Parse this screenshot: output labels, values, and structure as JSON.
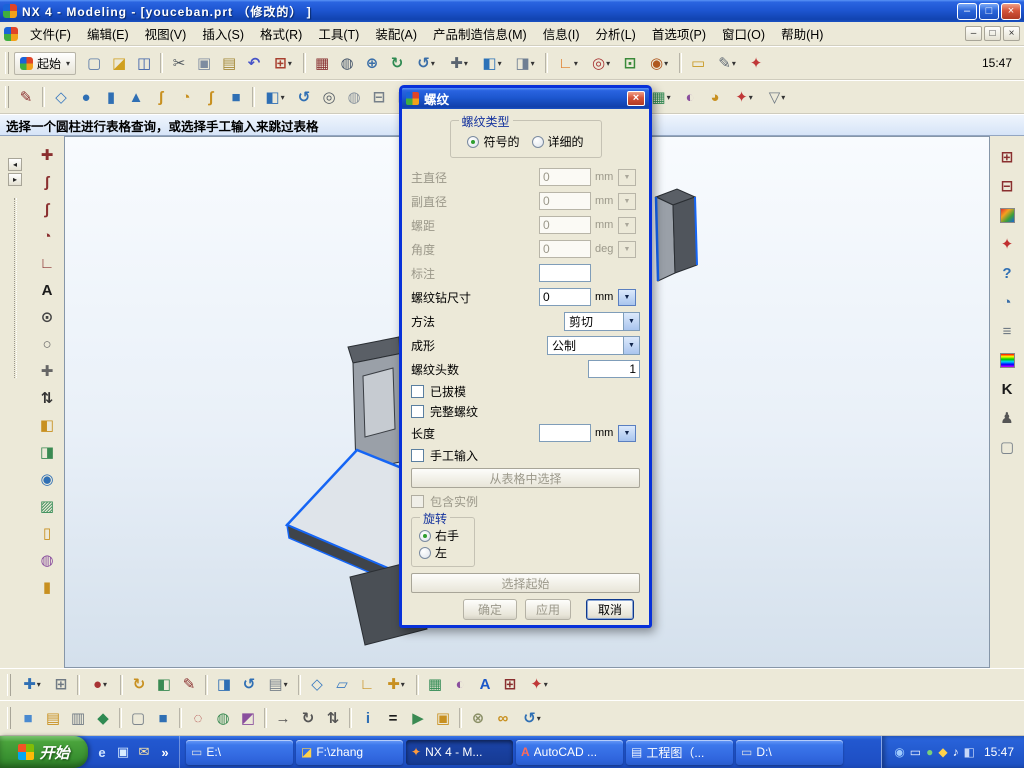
{
  "window": {
    "title": "NX 4 - Modeling - [youceban.prt （修改的） ]",
    "controls": {
      "minimize": "–",
      "maximize": "□",
      "close": "×"
    }
  },
  "menubar": {
    "items": [
      {
        "name": "file",
        "label": "文件(F)"
      },
      {
        "name": "edit",
        "label": "编辑(E)"
      },
      {
        "name": "view",
        "label": "视图(V)"
      },
      {
        "name": "insert",
        "label": "插入(S)"
      },
      {
        "name": "format",
        "label": "格式(R)"
      },
      {
        "name": "tools",
        "label": "工具(T)"
      },
      {
        "name": "assemblies",
        "label": "装配(A)"
      },
      {
        "name": "pmi",
        "label": "产品制造信息(M)"
      },
      {
        "name": "information",
        "label": "信息(I)"
      },
      {
        "name": "analysis",
        "label": "分析(L)"
      },
      {
        "name": "preferences",
        "label": "首选项(P)"
      },
      {
        "name": "window",
        "label": "窗口(O)"
      },
      {
        "name": "help",
        "label": "帮助(H)"
      }
    ],
    "mdi_controls": {
      "minimize": "–",
      "restore": "□",
      "close": "×"
    }
  },
  "toolbars": {
    "start_button": {
      "label": "起始"
    },
    "clock": "15:47",
    "row1": [
      {
        "name": "new-part",
        "glyph": "▢",
        "color": "#5a7aa8"
      },
      {
        "name": "open-part",
        "glyph": "◪",
        "color": "#d0a020"
      },
      {
        "name": "save-part",
        "glyph": "◫",
        "color": "#3a5fa8"
      },
      {
        "sep": true
      },
      {
        "name": "cut",
        "glyph": "✂",
        "color": "#50585f"
      },
      {
        "name": "copy",
        "glyph": "▣",
        "color": "#7e8ca0"
      },
      {
        "name": "paste",
        "glyph": "▤",
        "color": "#a58a3a"
      },
      {
        "name": "undo",
        "glyph": "↶",
        "color": "#4653c8"
      },
      {
        "name": "pick-filter",
        "glyph": "⊞",
        "color": "#a84030",
        "dropdown": true
      },
      {
        "sep": true
      },
      {
        "name": "fit-view",
        "glyph": "▦",
        "color": "#8a3434"
      },
      {
        "name": "zoom-window",
        "glyph": "◍",
        "color": "#48586c"
      },
      {
        "name": "zoom-in-out",
        "glyph": "⊕",
        "color": "#3a6ea8"
      },
      {
        "name": "refresh-view",
        "glyph": "↻",
        "color": "#2f8a52"
      },
      {
        "name": "rotate-view",
        "glyph": "↺",
        "color": "#3a6ea8",
        "dropdown": true
      },
      {
        "name": "pan-view",
        "glyph": "✚",
        "color": "#5a6470",
        "dropdown": true
      },
      {
        "name": "shaded-display",
        "glyph": "◧",
        "color": "#2c72b8",
        "dropdown": true
      },
      {
        "name": "wireframe-display",
        "glyph": "◨",
        "color": "#6f7f93",
        "dropdown": true
      },
      {
        "sep": true
      },
      {
        "name": "orient-csys",
        "glyph": "∟",
        "color": "#e07820",
        "dropdown": true
      },
      {
        "name": "snap-options",
        "glyph": "◎",
        "color": "#a83434",
        "dropdown": true
      },
      {
        "name": "layer-settings",
        "glyph": "⊡",
        "color": "#3a8a3a"
      },
      {
        "name": "selection-ball",
        "glyph": "◉",
        "color": "#b05820",
        "dropdown": true
      },
      {
        "sep": true
      },
      {
        "name": "measure-distance",
        "glyph": "▭",
        "color": "#c89820"
      },
      {
        "name": "annotation-pencil",
        "glyph": "✎",
        "color": "#606a75",
        "dropdown": true
      },
      {
        "name": "customize-wheel",
        "glyph": "✦",
        "color": "#c03838"
      }
    ],
    "row2": [
      {
        "name": "sketch",
        "glyph": "✎",
        "color": "#8a2f2f"
      },
      {
        "sep": true
      },
      {
        "name": "datum-plane",
        "glyph": "◇",
        "color": "#3a7ac0"
      },
      {
        "name": "sphere",
        "glyph": "●",
        "color": "#2f6fb4"
      },
      {
        "name": "cylinder",
        "glyph": "▮",
        "color": "#2f6fb4"
      },
      {
        "name": "cone",
        "glyph": "▲",
        "color": "#2f6fb4"
      },
      {
        "name": "studio-spline",
        "glyph": "ʃ",
        "color": "#c89020"
      },
      {
        "name": "arc-curve",
        "glyph": "◔",
        "color": "#c89020"
      },
      {
        "name": "helix",
        "glyph": "∫",
        "color": "#c89020"
      },
      {
        "name": "block",
        "glyph": "■",
        "color": "#2f6fb4"
      },
      {
        "sep": true
      },
      {
        "name": "extrude",
        "glyph": "◧",
        "color": "#2f6fb4",
        "dropdown": true
      },
      {
        "name": "revolve",
        "glyph": "↺",
        "color": "#2f6fb4"
      },
      {
        "name": "hole",
        "glyph": "◎",
        "color": "#565e66"
      },
      {
        "name": "boss",
        "glyph": "◍",
        "color": "#8a949e"
      },
      {
        "name": "pocket",
        "glyph": "⊟",
        "color": "#76808a"
      },
      {
        "name": "pad",
        "glyph": "⊞",
        "color": "#76808a"
      },
      {
        "name": "thread-feature",
        "glyph": "ξ",
        "color": "#b07c20"
      },
      {
        "sep": true
      },
      {
        "name": "unite",
        "glyph": "⊕",
        "color": "#2f6fb4"
      },
      {
        "name": "subtract",
        "glyph": "⊖",
        "color": "#2f6fb4"
      },
      {
        "name": "intersect",
        "glyph": "⊗",
        "color": "#2f6fb4"
      },
      {
        "name": "edge-blend",
        "glyph": "◈",
        "color": "#3a7ac0",
        "dropdown": true
      },
      {
        "name": "chamfer",
        "glyph": "◣",
        "color": "#3a7ac0"
      },
      {
        "name": "shell",
        "glyph": "▢",
        "color": "#3a7ac0"
      },
      {
        "name": "trim-body",
        "glyph": "✂",
        "color": "#707a84"
      },
      {
        "sep": true
      },
      {
        "name": "instance-array",
        "glyph": "▦",
        "color": "#2f8a52",
        "dropdown": true
      },
      {
        "name": "mirror-body",
        "glyph": "◐",
        "color": "#8a4f9e"
      },
      {
        "name": "free-form",
        "glyph": "◕",
        "color": "#c89020"
      },
      {
        "name": "gear-tools",
        "glyph": "✦",
        "color": "#c03838",
        "dropdown": true
      },
      {
        "name": "points-filter",
        "glyph": "▽",
        "color": "#707a84",
        "dropdown": true
      }
    ]
  },
  "prompt": {
    "text": "选择一个圆柱进行表格查询，或选择手工输入来跳过表格"
  },
  "workarea": {
    "dock_left": "◂",
    "dock_right": "▸"
  },
  "left_toolbar": [
    {
      "name": "point-constructor",
      "glyph": "✚",
      "color": "#8a2f2f"
    },
    {
      "name": "profile-curve",
      "glyph": "ʃ",
      "color": "#8a2f2f"
    },
    {
      "name": "sketch-spline",
      "glyph": "∫",
      "color": "#8a2f2f"
    },
    {
      "name": "arc-tool",
      "glyph": "◔",
      "color": "#8a2f2f"
    },
    {
      "name": "derived-line",
      "glyph": "∟",
      "color": "#8a2f2f"
    },
    {
      "name": "text-tool",
      "glyph": "A",
      "color": "#1a1a1a"
    },
    {
      "name": "circle-center",
      "glyph": "⊙",
      "color": "#444444"
    },
    {
      "name": "circle-tool",
      "glyph": "○",
      "color": "#666666"
    },
    {
      "name": "point-tool",
      "glyph": "✚",
      "color": "#666666"
    },
    {
      "name": "expand-tools",
      "glyph": "⇅",
      "color": "#333333"
    },
    {
      "name": "ruled-surface",
      "glyph": "◧",
      "color": "#c89020"
    },
    {
      "name": "through-curves",
      "glyph": "◨",
      "color": "#3a8a52"
    },
    {
      "name": "swept-surface",
      "glyph": "◉",
      "color": "#2f6fb4"
    },
    {
      "name": "mesh-surface",
      "glyph": "▨",
      "color": "#2f8a52"
    },
    {
      "name": "n-sided-surface",
      "glyph": "▯",
      "color": "#c89020"
    },
    {
      "name": "studio-surface",
      "glyph": "◍",
      "color": "#8a4f9e"
    },
    {
      "name": "tube-surface",
      "glyph": "▮",
      "color": "#c89020"
    }
  ],
  "right_toolbar": [
    {
      "name": "part-navigator",
      "glyph": "⊞",
      "color": "#8a2f2f"
    },
    {
      "name": "assembly-navigator",
      "glyph": "⊟",
      "color": "#8a2f2f"
    },
    {
      "name": "color-palette",
      "glyph": "",
      "bg": "linear-gradient(135deg,#e03030,#f5a020,#3aa03a,#1a63d8)"
    },
    {
      "name": "reuse-library",
      "glyph": "✦",
      "color": "#c03030"
    },
    {
      "name": "help",
      "glyph": "?",
      "color": "#2f6fb4"
    },
    {
      "name": "history-clock",
      "glyph": "◔",
      "color": "#3a6ea8"
    },
    {
      "name": "details-list",
      "glyph": "≡",
      "color": "#707a84"
    },
    {
      "name": "rainbow-strip",
      "glyph": "",
      "bg": "linear-gradient(180deg,#f00,#ff0,#0c0,#0cf,#00f,#c0f)"
    },
    {
      "name": "curve-analysis",
      "glyph": "K",
      "color": "#1a1a1a"
    },
    {
      "name": "roles-person",
      "glyph": "♟",
      "color": "#555555"
    },
    {
      "name": "blank-sheet",
      "glyph": "▢",
      "color": "#707a84"
    }
  ],
  "bottom_toolbars": {
    "row1": [
      {
        "name": "selection-intent",
        "glyph": "✚",
        "color": "#2f6fb4",
        "dropdown": true
      },
      {
        "name": "snap-grid",
        "glyph": "⊞",
        "color": "#707a84"
      },
      {
        "sep": true
      },
      {
        "name": "point-on-curve",
        "glyph": "●",
        "color": "#a83434",
        "dropdown": true
      },
      {
        "sep": true
      },
      {
        "name": "dynamic-wcs",
        "glyph": "↻",
        "color": "#c89020"
      },
      {
        "name": "orient-view",
        "glyph": "◧",
        "color": "#3a8a52"
      },
      {
        "name": "sketch-in-task",
        "glyph": "✎",
        "color": "#8a2f2f"
      },
      {
        "sep": true
      },
      {
        "name": "extrude-mini",
        "glyph": "◨",
        "color": "#2f6fb4"
      },
      {
        "name": "revolve-mini",
        "glyph": "↺",
        "color": "#2f6fb4"
      },
      {
        "name": "sheet-tools",
        "glyph": "▤",
        "color": "#76808a",
        "dropdown": true
      },
      {
        "sep": true
      },
      {
        "name": "datum-mini",
        "glyph": "◇",
        "color": "#3a7ac0"
      },
      {
        "name": "plane-mini",
        "glyph": "▱",
        "color": "#3a7ac0"
      },
      {
        "name": "axis-mini",
        "glyph": "∟",
        "color": "#c89020"
      },
      {
        "name": "csys-mini",
        "glyph": "✚",
        "color": "#c89020",
        "dropdown": true
      },
      {
        "sep": true
      },
      {
        "name": "pattern-mini",
        "glyph": "▦",
        "color": "#2f8a52"
      },
      {
        "name": "mirror-mini",
        "glyph": "◐",
        "color": "#8a4f9e"
      },
      {
        "name": "text-annotation",
        "glyph": "A",
        "color": "#1a57c8"
      },
      {
        "name": "table-mini",
        "glyph": "⊞",
        "color": "#8a2f2f"
      },
      {
        "name": "options-mini",
        "glyph": "✦",
        "color": "#c03838",
        "dropdown": true
      }
    ],
    "row2": [
      {
        "name": "view-front",
        "glyph": "■",
        "color": "#4a8ad0"
      },
      {
        "name": "view-top",
        "glyph": "▤",
        "color": "#c89020"
      },
      {
        "name": "view-right",
        "glyph": "▥",
        "color": "#707a84"
      },
      {
        "name": "view-isometric",
        "glyph": "◆",
        "color": "#2f8a52"
      },
      {
        "sep": true
      },
      {
        "name": "wireframe-mode",
        "glyph": "▢",
        "color": "#707a84"
      },
      {
        "name": "shaded-mode",
        "glyph": "■",
        "color": "#2f6fb4"
      },
      {
        "sep": true
      },
      {
        "name": "hide-object",
        "glyph": "◌",
        "color": "#a83434"
      },
      {
        "name": "show-object",
        "glyph": "◍",
        "color": "#3a8a52"
      },
      {
        "name": "edit-display",
        "glyph": "◩",
        "color": "#8a4f9e"
      },
      {
        "sep": true
      },
      {
        "name": "move-object",
        "glyph": "→",
        "color": "#555555"
      },
      {
        "name": "rotate-object",
        "glyph": "↻",
        "color": "#555555"
      },
      {
        "name": "scale-object",
        "glyph": "⇅",
        "color": "#555555"
      },
      {
        "sep": true
      },
      {
        "name": "info-window",
        "glyph": "i",
        "color": "#2f6fb4"
      },
      {
        "name": "expression",
        "glyph": "=",
        "color": "#1a1a1a"
      },
      {
        "name": "play-macro",
        "glyph": "▶",
        "color": "#3a8a52"
      },
      {
        "name": "journal",
        "glyph": "▣",
        "color": "#c89020"
      },
      {
        "sep": true
      },
      {
        "name": "wave-link",
        "glyph": "⊗",
        "color": "#8a8f66"
      },
      {
        "name": "chain-link",
        "glyph": "∞",
        "color": "#c89020"
      },
      {
        "name": "update-model",
        "glyph": "↺",
        "color": "#2f6fb4",
        "dropdown": true
      }
    ]
  },
  "dialog": {
    "title": "螺纹",
    "close_glyph": "×",
    "thread_type_group": {
      "label": "螺纹类型",
      "options": [
        {
          "label": "符号的",
          "selected": true
        },
        {
          "label": "详细的",
          "selected": false
        }
      ]
    },
    "fields": {
      "major_diameter": {
        "label": "主直径",
        "value": "0",
        "unit": "mm"
      },
      "minor_diameter": {
        "label": "副直径",
        "value": "0",
        "unit": "mm"
      },
      "pitch": {
        "label": "螺距",
        "value": "0",
        "unit": "mm"
      },
      "angle": {
        "label": "角度",
        "value": "0",
        "unit": "deg"
      },
      "callout": {
        "label": "标注",
        "value": ""
      },
      "tap_drill": {
        "label": "螺纹钻尺寸",
        "value": "0",
        "unit": "mm"
      },
      "method": {
        "label": "方法",
        "value": "剪切"
      },
      "form": {
        "label": "成形",
        "value": "公制"
      },
      "starts": {
        "label": "螺纹头数",
        "value": "1"
      },
      "length": {
        "label": "长度",
        "value": "",
        "unit": "mm"
      }
    },
    "checkboxes": {
      "tapered": {
        "label": "已拔模",
        "checked": false
      },
      "full_thread": {
        "label": "完整螺纹",
        "checked": false
      },
      "manual_input": {
        "label": "手工输入",
        "checked": false
      },
      "include_instances": {
        "label": "包含实例",
        "checked": false
      }
    },
    "from_table_button": "从表格中选择",
    "rotation_group": {
      "label": "旋转",
      "options": [
        {
          "label": "右手",
          "selected": true
        },
        {
          "label": "左",
          "selected": false
        }
      ]
    },
    "select_start_button": "选择起始",
    "buttons": {
      "ok": "确定",
      "apply": "应用",
      "cancel": "取消"
    }
  },
  "taskbar": {
    "start_label": "开始",
    "quick_launch": [
      {
        "name": "internet-explorer",
        "glyph": "e",
        "color": "#cfe4ff"
      },
      {
        "name": "show-desktop",
        "glyph": "▣",
        "color": "#d8ecff"
      },
      {
        "name": "mail",
        "glyph": "✉",
        "color": "#ffe9a8"
      },
      {
        "name": "more-chevron",
        "glyph": "»",
        "color": "#ffffff"
      }
    ],
    "tasks": [
      {
        "name": "e-drive",
        "icon_glyph": "▭",
        "icon_color": "#d8dce4",
        "label": "E:\\"
      },
      {
        "name": "f-zhang",
        "icon_glyph": "◪",
        "icon_color": "#ffd24a",
        "label": "F:\\zhang"
      },
      {
        "name": "nx",
        "icon_glyph": "✦",
        "icon_color": "#ff9a3c",
        "label": "NX 4 - M...",
        "active": true
      },
      {
        "name": "autocad",
        "icon_glyph": "A",
        "icon_color": "#ff6a5a",
        "label": "AutoCAD ..."
      },
      {
        "name": "drawing",
        "icon_glyph": "▤",
        "icon_color": "#e8f0ff",
        "label": "工程图（..."
      },
      {
        "name": "d-drive",
        "icon_glyph": "▭",
        "icon_color": "#d8dce4",
        "label": "D:\\"
      }
    ],
    "tray": {
      "icons": [
        {
          "name": "network",
          "glyph": "◉",
          "color": "#9ecbff"
        },
        {
          "name": "keyboard-layout",
          "glyph": "▭",
          "color": "#e8eefc"
        },
        {
          "name": "antivirus",
          "glyph": "●",
          "color": "#7ad07a"
        },
        {
          "name": "messenger",
          "glyph": "◆",
          "color": "#ffd24a"
        },
        {
          "name": "volume",
          "glyph": "♪",
          "color": "#ffffff"
        },
        {
          "name": "usb-device",
          "glyph": "◧",
          "color": "#c8d8f8"
        }
      ],
      "time": "15:47"
    }
  },
  "colors": {
    "titlebar_blue": "#1c56ce",
    "dialog_border": "#0831d9",
    "taskbar_blue": "#2258d0",
    "start_green": "#389030",
    "model_highlight": "#1565f5"
  }
}
